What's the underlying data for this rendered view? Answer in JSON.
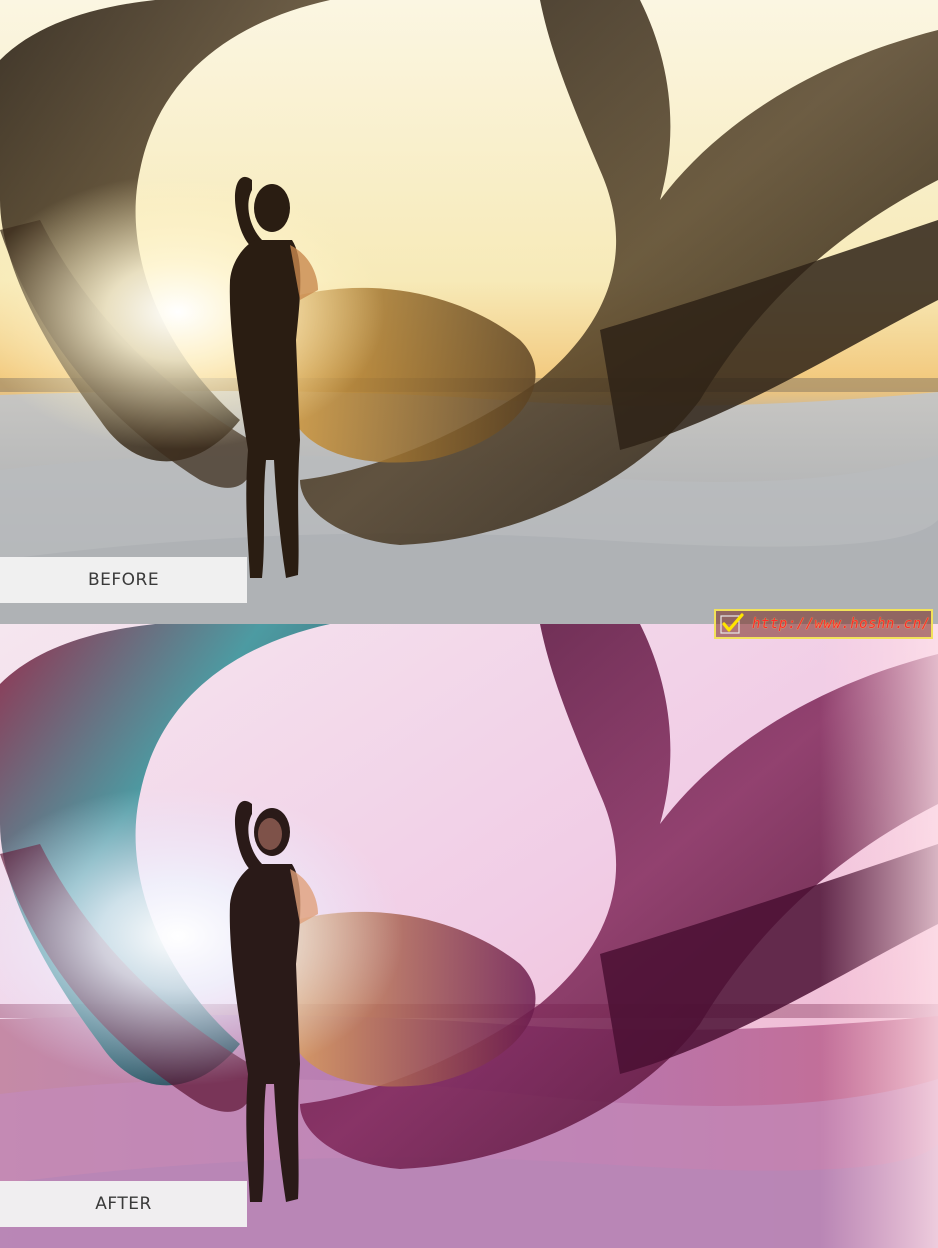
{
  "labels": {
    "before": "BEFORE",
    "after": "AFTER"
  },
  "watermark": {
    "url": "http://www.hoshn.cn/",
    "icon": "check-icon",
    "color": "#ff2a2a",
    "border_color": "#f2e25a"
  },
  "palette": {
    "before_sky": "#f6ecc4",
    "before_fabric": "#3b2c1a",
    "after_sky": "#f2c7e3",
    "after_fabric": "#6b1b4d",
    "after_teal": "#2f8f95"
  }
}
